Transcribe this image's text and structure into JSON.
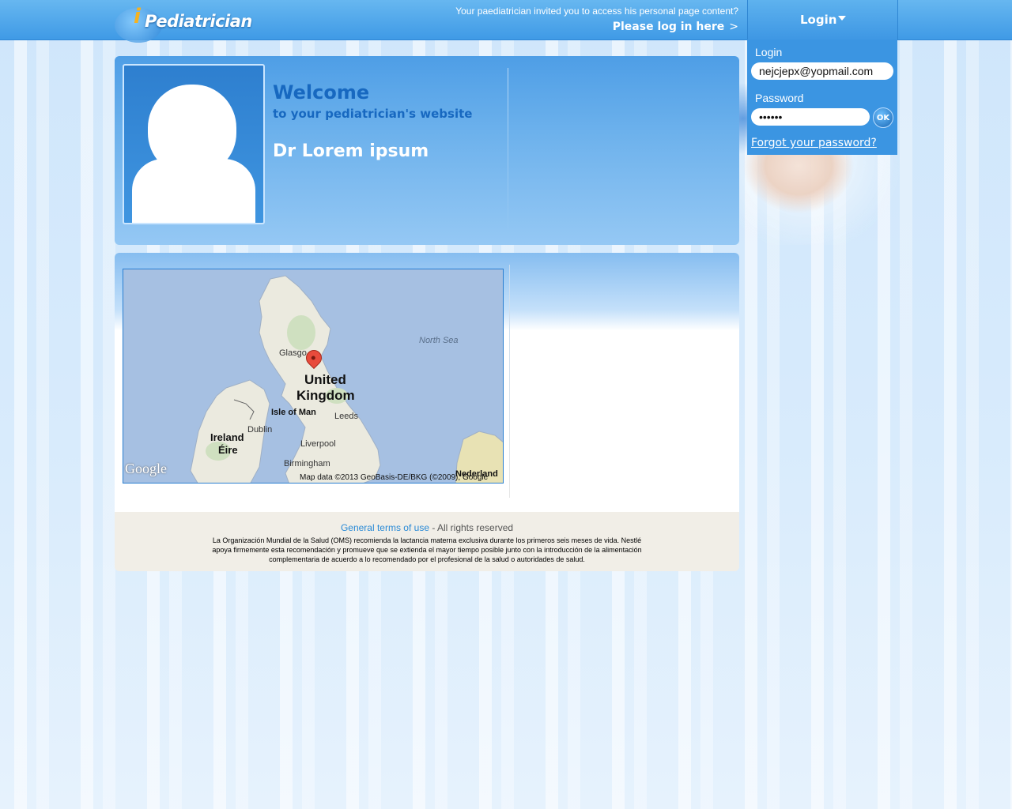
{
  "topbar": {
    "logo_i": "i",
    "logo_text": "Pediatrician",
    "invite_text": "Your paediatrician invited you to access his personal page content?",
    "login_here": "Please log in here",
    "login_here_arrow": ">"
  },
  "login": {
    "tab_label": "Login",
    "login_label": "Login",
    "login_value": "nejcjepx@yopmail.com",
    "password_label": "Password",
    "password_value": "pswrd1",
    "ok_label": "OK",
    "forgot_label": "Forgot your password?"
  },
  "profile": {
    "welcome": "Welcome",
    "welcome_sub": "to your pediatrician's website",
    "doctor_name": "Dr Lorem ipsum"
  },
  "map": {
    "north_sea": "North Sea",
    "glasgow": "Glasgo",
    "uk_line1": "United",
    "uk_line2": "Kingdom",
    "isle_of_man": "Isle of Man",
    "leeds": "Leeds",
    "dublin": "Dublin",
    "ireland": "Ireland",
    "eire": "Éire",
    "liverpool": "Liverpool",
    "birmingham": "Birmingham",
    "nederland": "Nederland",
    "google": "Google",
    "attribution": "Map data ©2013 GeoBasis-DE/BKG (©2009), Google"
  },
  "footer": {
    "terms_link": "General terms of use",
    "rights": " - All rights reserved",
    "legal": "La Organización Mundial de la Salud (OMS) recomienda la lactancia materna exclusiva durante los primeros seis meses de vida. Nestlé apoya firmemente esta recomendación y promueve que se extienda el mayor tiempo posible junto con la introducción de la alimentación complementaria de acuerdo a lo recomendado por el profesional de la salud o autoridades de salud."
  },
  "colors": {
    "topbar": "#3f9ae6",
    "accent": "#1768c0",
    "link": "#2a8ad6",
    "footer_bg": "#f1eee7"
  }
}
